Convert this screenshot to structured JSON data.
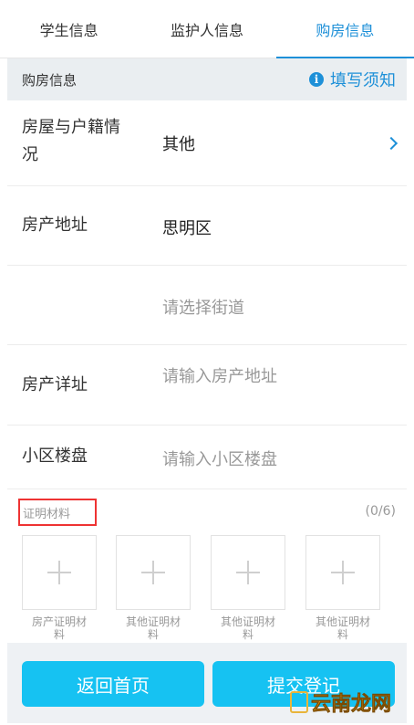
{
  "tabs": [
    {
      "label": "学生信息"
    },
    {
      "label": "监护人信息"
    },
    {
      "label": "购房信息"
    }
  ],
  "section": {
    "title": "购房信息",
    "notice_label": "填写须知",
    "notice_icon": "info-icon"
  },
  "form": {
    "household": {
      "label_line1": "房屋与户籍情",
      "label_line2": "况",
      "value": "其他"
    },
    "address": {
      "label": "房产地址",
      "value": "思明区"
    },
    "street": {
      "placeholder": "请选择街道"
    },
    "detail": {
      "label": "房产详址",
      "placeholder": "请输入房产地址"
    },
    "community": {
      "label": "小区楼盘",
      "placeholder": "请输入小区楼盘"
    }
  },
  "upload": {
    "title": "证明材料",
    "count": "(0/6)",
    "items": [
      {
        "line1": "房产证明材",
        "line2": "料"
      },
      {
        "line1": "其他证明材",
        "line2": "料"
      },
      {
        "line1": "其他证明材",
        "line2": "料"
      },
      {
        "line1": "其他证明材",
        "line2": "料"
      }
    ]
  },
  "buttons": {
    "back": "返回首页",
    "submit": "提交登记"
  },
  "watermark": {
    "text": "云南龙网"
  },
  "colors": {
    "accent": "#1e90d8",
    "button": "#16c2f2",
    "highlight_border": "#ee3333"
  }
}
